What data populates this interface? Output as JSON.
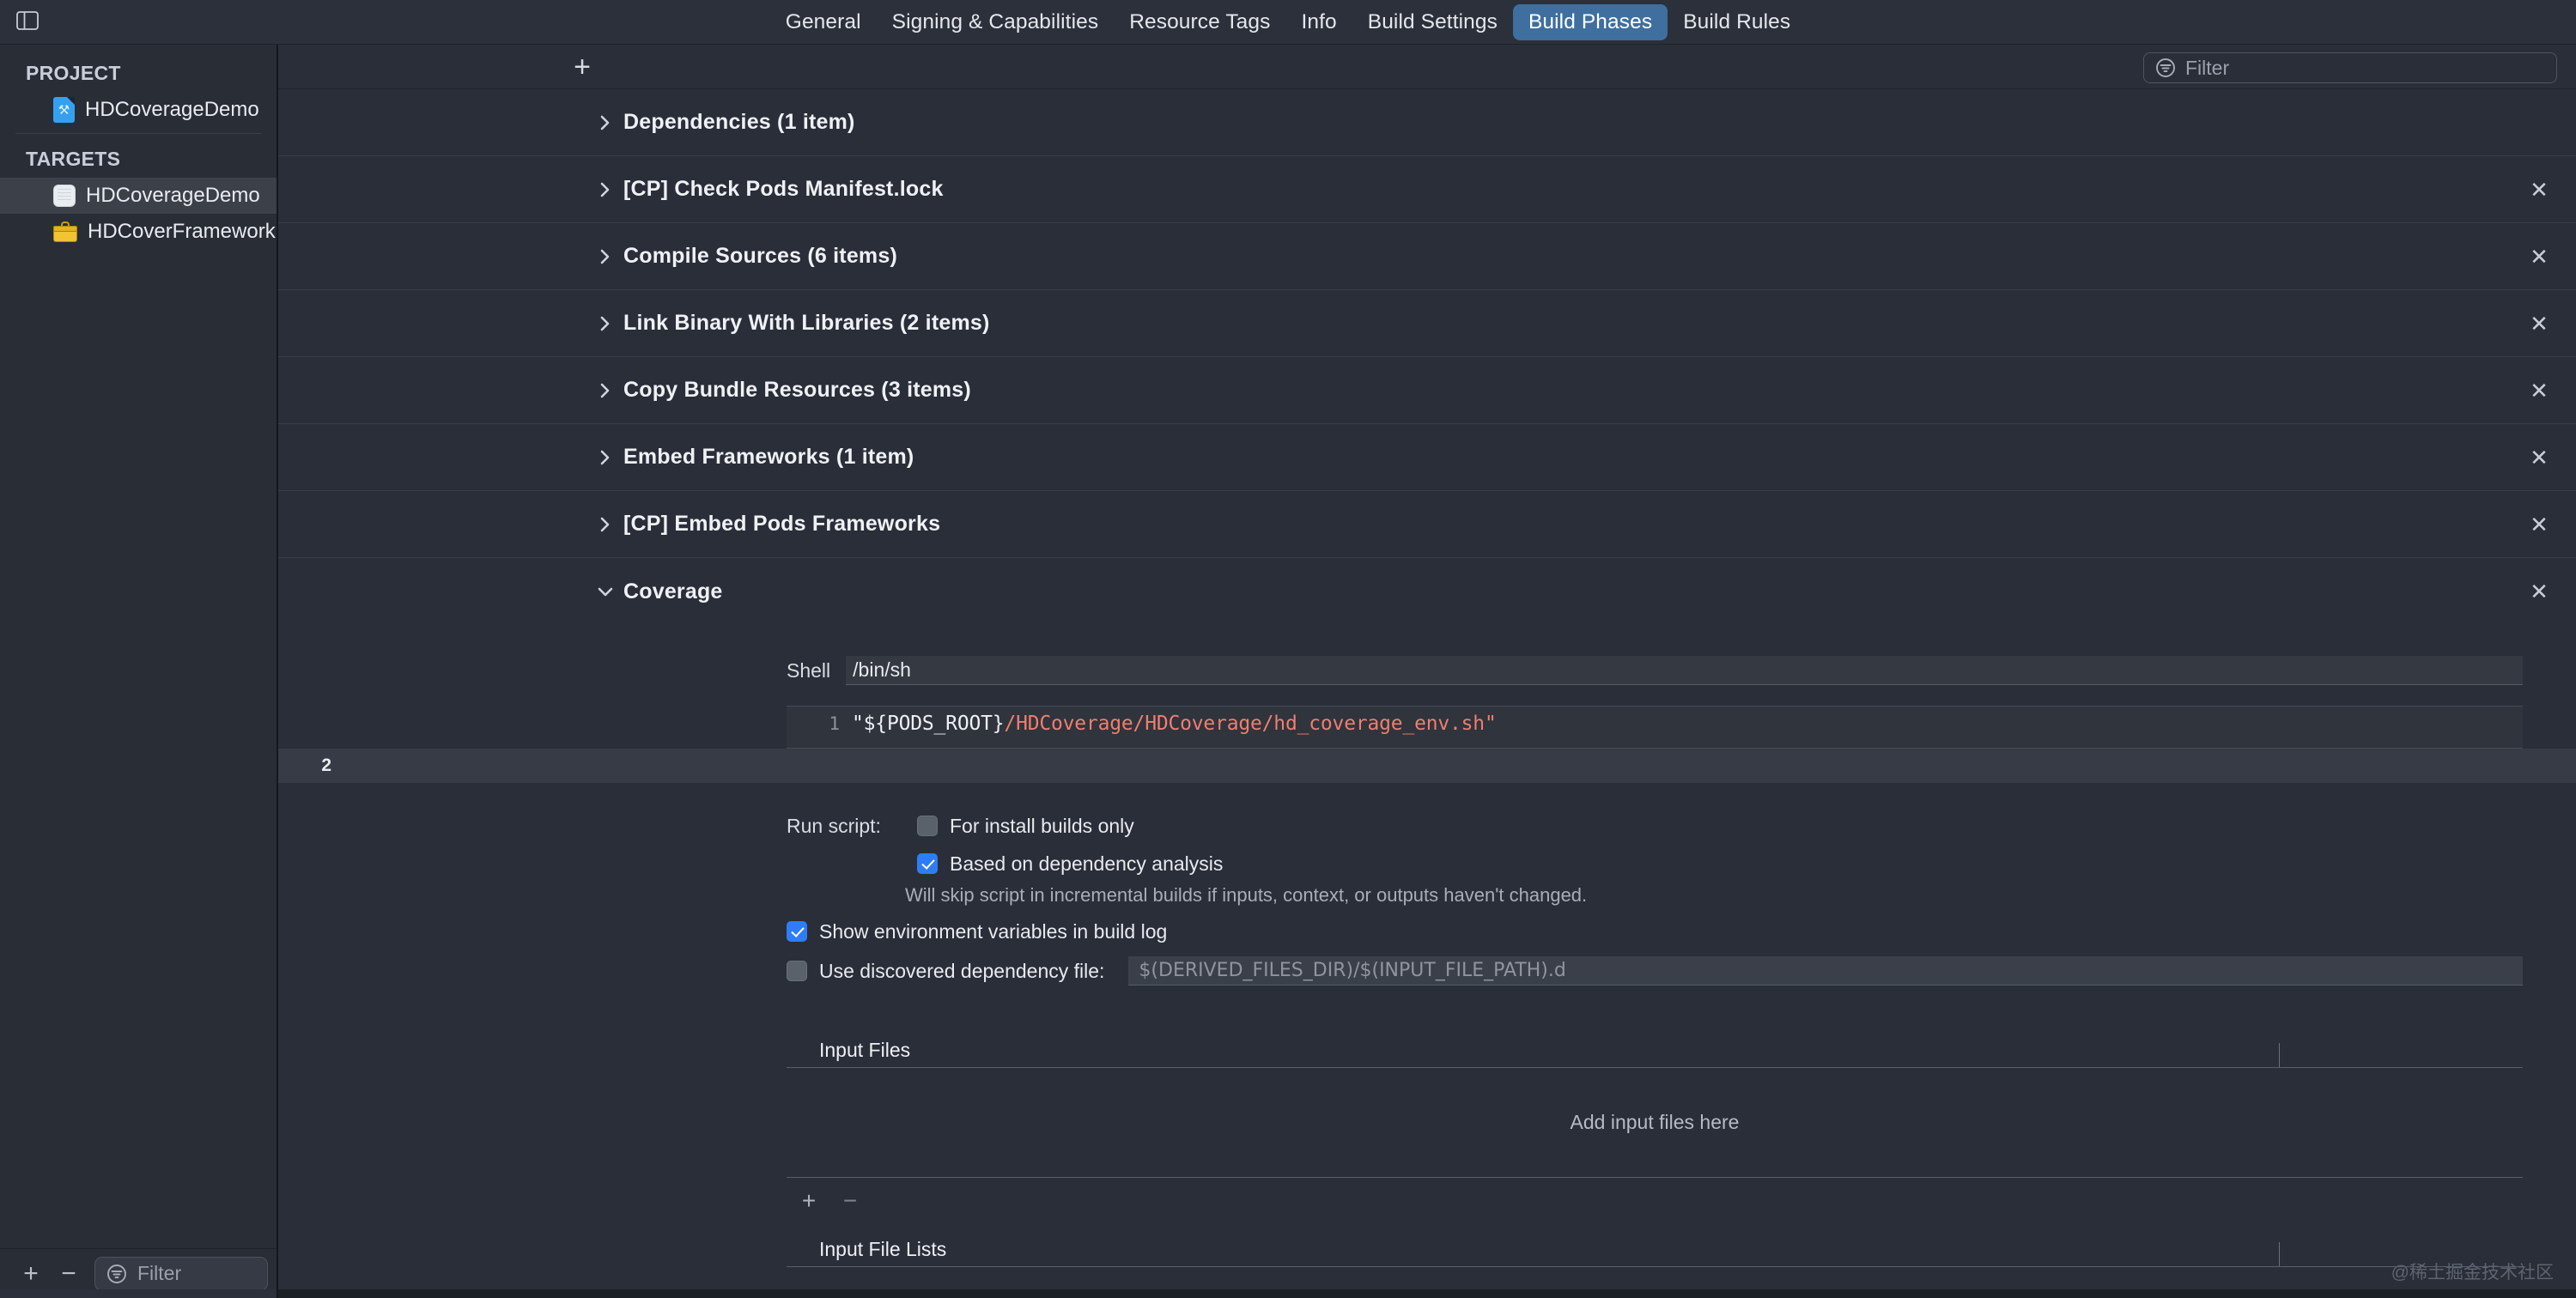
{
  "window": {
    "sidebar_toggle_icon": "sidebar-toggle-icon"
  },
  "tabs": [
    {
      "label": "General",
      "active": false
    },
    {
      "label": "Signing & Capabilities",
      "active": false
    },
    {
      "label": "Resource Tags",
      "active": false
    },
    {
      "label": "Info",
      "active": false
    },
    {
      "label": "Build Settings",
      "active": false
    },
    {
      "label": "Build Phases",
      "active": true
    },
    {
      "label": "Build Rules",
      "active": false
    }
  ],
  "sidebar": {
    "project_section": {
      "title": "PROJECT",
      "items": [
        {
          "label": "HDCoverageDemo",
          "icon": "xcode-project-icon",
          "selected": false
        }
      ]
    },
    "targets_section": {
      "title": "TARGETS",
      "items": [
        {
          "label": "HDCoverageDemo",
          "icon": "app-target-icon",
          "selected": true
        },
        {
          "label": "HDCoverFramework",
          "icon": "framework-toolbox-icon",
          "selected": false
        }
      ]
    },
    "footer": {
      "add_label": "+",
      "remove_label": "−",
      "filter_placeholder": "Filter",
      "filter_icon": "filter-icon"
    }
  },
  "main": {
    "add_phase_label": "+",
    "filter_placeholder": "Filter",
    "filter_icon": "filter-icon",
    "phases": [
      {
        "title": "Dependencies (1 item)",
        "expanded": false,
        "removable": false
      },
      {
        "title": "[CP] Check Pods Manifest.lock",
        "expanded": false,
        "removable": true
      },
      {
        "title": "Compile Sources (6 items)",
        "expanded": false,
        "removable": true
      },
      {
        "title": "Link Binary With Libraries (2 items)",
        "expanded": false,
        "removable": true
      },
      {
        "title": "Copy Bundle Resources (3 items)",
        "expanded": false,
        "removable": true
      },
      {
        "title": "Embed Frameworks (1 item)",
        "expanded": false,
        "removable": true
      },
      {
        "title": "[CP] Embed Pods Frameworks",
        "expanded": false,
        "removable": true
      },
      {
        "title": "Coverage",
        "expanded": true,
        "removable": true
      }
    ]
  },
  "coverage_detail": {
    "shell": {
      "label": "Shell",
      "value": "/bin/sh"
    },
    "script": {
      "lines": [
        {
          "number": "1",
          "current": false,
          "segments": [
            {
              "text": "\"${PODS_ROOT}",
              "style": "plain"
            },
            {
              "text": "/HDCoverage/HDCoverage/hd_coverage_env.sh\"",
              "style": "path"
            }
          ]
        },
        {
          "number": "2",
          "current": true,
          "segments": []
        }
      ]
    },
    "run_script": {
      "lead_label": "Run script:",
      "install_only": {
        "label": "For install builds only",
        "checked": false
      },
      "dependency_analysis": {
        "label": "Based on dependency analysis",
        "checked": true
      },
      "dependency_note": "Will skip script in incremental builds if inputs, context, or outputs haven't changed."
    },
    "show_env_vars": {
      "label": "Show environment variables in build log",
      "checked": true
    },
    "discovered_dependency": {
      "label": "Use discovered dependency file:",
      "checked": false,
      "placeholder": "$(DERIVED_FILES_DIR)/$(INPUT_FILE_PATH).d"
    },
    "input_files": {
      "column_header": "Input Files",
      "empty_message": "Add input files here",
      "add_label": "+",
      "remove_label": "−"
    },
    "input_file_lists": {
      "column_header": "Input File Lists"
    }
  },
  "watermark": "@稀土掘金技术社区"
}
